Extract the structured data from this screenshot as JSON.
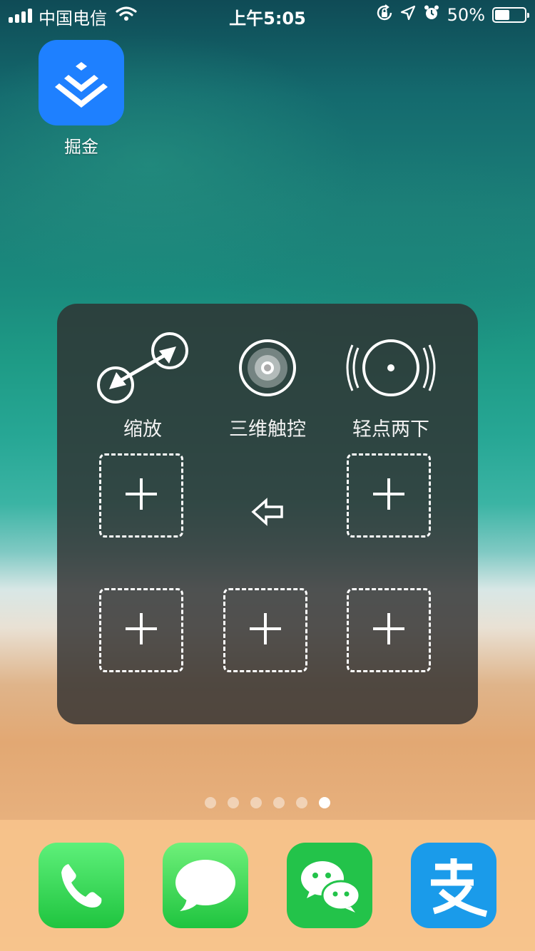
{
  "status_bar": {
    "carrier": "中国电信",
    "time": "上午5:05",
    "battery_percent": "50%",
    "battery_level": 0.5,
    "signal_bars": 4,
    "icons": [
      "signal-icon",
      "wifi-icon",
      "orientation-lock-icon",
      "location-icon",
      "alarm-icon",
      "battery-icon"
    ]
  },
  "home_apps": [
    {
      "name": "掘金",
      "icon": "juejin-icon",
      "color": "#1e80ff"
    }
  ],
  "assistive_menu": {
    "top_items": [
      {
        "label": "缩放",
        "icon": "zoom-icon"
      },
      {
        "label": "三维触控",
        "icon": "3d-touch-icon"
      },
      {
        "label": "轻点两下",
        "icon": "double-tap-icon"
      }
    ],
    "add_slots": 5,
    "back_icon": "back-arrow-icon"
  },
  "page_indicator": {
    "total": 6,
    "active_index": 5
  },
  "dock": [
    {
      "name": "Phone",
      "icon": "phone-icon",
      "color": "#2fd158"
    },
    {
      "name": "Messages",
      "icon": "messages-icon",
      "color": "#2fd158"
    },
    {
      "name": "WeChat",
      "icon": "wechat-icon",
      "color": "#23c34a"
    },
    {
      "name": "Alipay",
      "icon": "alipay-icon",
      "color": "#1a9bea"
    }
  ]
}
